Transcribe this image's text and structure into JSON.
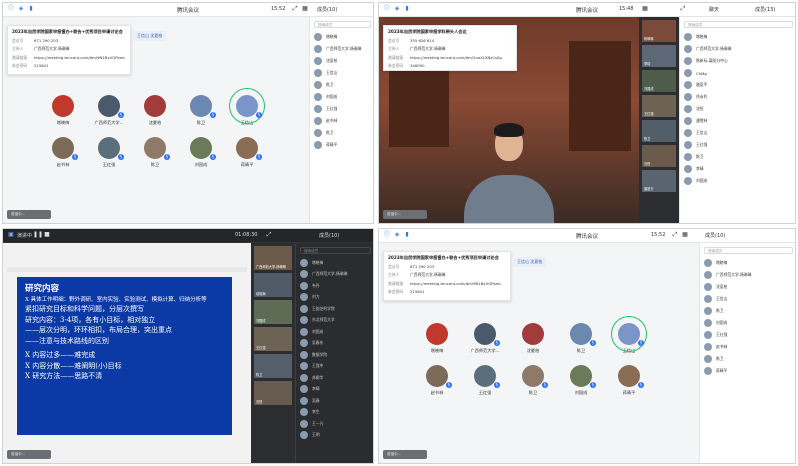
{
  "app": {
    "title": "腾讯会议",
    "time": "15:52",
    "time_w2": "15:48",
    "time_w3": "01:08:30"
  },
  "meeting": {
    "subject": "2023年自然学院国家申报督办+联合+优秀项目申请讨论会",
    "subject_w2": "2023年自然学院国家申报学科带头人会议",
    "labels": {
      "id": "会议号",
      "host": "主持人",
      "link": "邀请链接",
      "password": "参会密码"
    },
    "id": "671 290 203",
    "id_w2": "355 626 614",
    "host": "广西师范大学-杨琳琳",
    "link": "https://meeting.tencent.com/dm/9N1BxVQPomL",
    "link_w2": "https://meeting.tencent.com/dm/2noXLXNsCs0g",
    "password": "215841",
    "password_w2": "346090"
  },
  "toast": {
    "text": "王信山 沈夏柏"
  },
  "participants": {
    "header": "成员(10)",
    "search_placeholder": "搜索成员",
    "list": [
      "增晓梅",
      "广西师范大学-杨琳琳",
      "沈夏柏",
      "王信山",
      "陈卫",
      "刘国成",
      "王红强",
      "赵书林",
      "陈卫",
      "蒋晴平"
    ]
  },
  "participants_w2": {
    "header": "成员(13)",
    "list": [
      "增晓梅",
      "广西师范大学-杨琳琳",
      "陈新标-襄阳分中心",
      "ChMg",
      "唐夏平",
      "徐永利",
      "沈恒",
      "潘雪林",
      "王信山",
      "王红强",
      "陈卫",
      "李晴",
      "刘国成"
    ]
  },
  "participants_w3": {
    "search_placeholder": "搜索成员",
    "list": [
      "增晓梅",
      "广西师范大学-杨琳琳",
      "韦丹",
      "刘力",
      "王韵芝的学院",
      "东北师范大学",
      "刘国成",
      "吴春东",
      "数据学院",
      "王强中",
      "苏柳华",
      "李晴",
      "吴春",
      "李生",
      "王一凡",
      "王明"
    ]
  },
  "gallery": [
    {
      "name": "增晓梅",
      "color": "#c0392b"
    },
    {
      "name": "广西师范大学...",
      "color": "#4a5a6a"
    },
    {
      "name": "沈夏柏",
      "color": "#a23b3b"
    },
    {
      "name": "陈卫",
      "color": "#6a88b0"
    },
    {
      "name": "王信山",
      "color": "#7a95c8"
    },
    {
      "name": "赵书林",
      "color": "#7d6b5a"
    },
    {
      "name": "王红强",
      "color": "#5a6f7a"
    },
    {
      "name": "陈卫",
      "color": "#8f7a6a"
    },
    {
      "name": "刘国成",
      "color": "#6b7b5a"
    },
    {
      "name": "蒋晴平",
      "color": "#8a6d55"
    }
  ],
  "bottom": {
    "hint": "说话中..."
  },
  "share": {
    "label": "演讲中",
    "slide_lines": [
      "研究内容",
      "X 具体工作明细：野外调研、室内实验、实验测试、模拟计算、归纳分析等",
      "紧扣研究目标和科学问题，分层次撰写",
      "研究内容：3-4项，各有小目标，相对独立",
      "——层次分明，环环相扣，布局合理，突出重点",
      "——注意与技术路线的区别",
      "X 内容过多——难完成",
      "X 内容分散——难阐明(小)目标",
      "X 研究方法——思路不清"
    ]
  },
  "thumbs_w2": [
    "杨琳琳",
    "李晴",
    "刘国成",
    "王红强",
    "陈卫",
    "沈恒",
    "唐夏平"
  ],
  "thumbs_w3": [
    "广西师范大学-杨琳琳",
    "增晓梅",
    "刘国成",
    "王红强",
    "陈卫",
    "沈恒"
  ],
  "colors": {
    "accent": "#2f6ff0",
    "active": "#21c36b",
    "slide": "#0b3aa6"
  }
}
